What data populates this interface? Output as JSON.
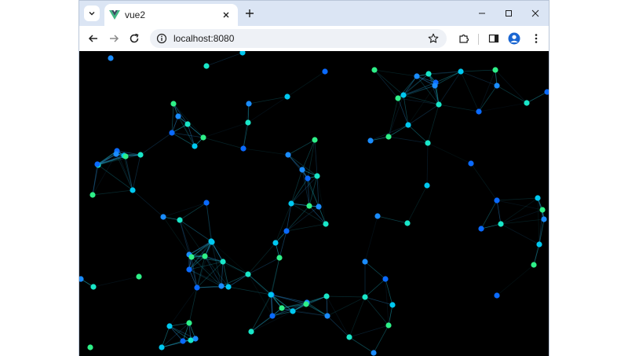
{
  "browser": {
    "tab_title": "vue2",
    "url": "localhost:8080"
  },
  "icons": {
    "tab_search": "chevron-down-icon",
    "favicon": "vue-logo-icon",
    "tab_close": "close-icon",
    "new_tab": "plus-icon",
    "minimize": "minimize-icon",
    "maximize": "maximize-icon",
    "close_window": "close-icon",
    "back": "arrow-left-icon",
    "forward": "arrow-right-icon",
    "reload": "reload-icon",
    "site_info": "info-icon",
    "bookmark": "star-icon",
    "extensions": "puzzle-icon",
    "side_panel": "side-panel-icon",
    "profile": "profile-icon",
    "menu": "kebab-menu-icon"
  },
  "colors": {
    "canvas_background": "#000000",
    "node_colors": [
      "#1a8cff",
      "#00c8f0",
      "#19e6c8",
      "#2ef088",
      "#0a6aff"
    ]
  }
}
